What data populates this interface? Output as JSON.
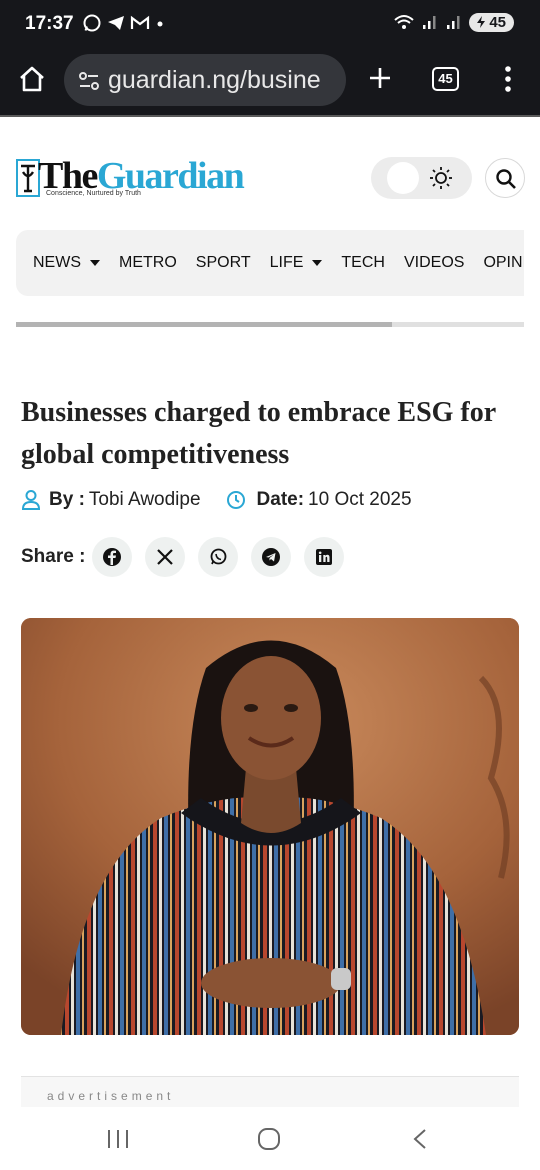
{
  "status_bar": {
    "time": "17:37",
    "battery": "45",
    "icons": [
      "whatsapp-icon",
      "telegram-icon",
      "gmail-icon",
      "dot-icon",
      "wifi-icon",
      "signal-icon",
      "signal-icon",
      "battery-icon"
    ]
  },
  "browser": {
    "url": "guardian.ng/busine",
    "tab_count": "45"
  },
  "site": {
    "logo_the": "The",
    "logo_guardian": "Guardian",
    "tagline": "Conscience, Nurtured by Truth"
  },
  "nav": {
    "items": [
      {
        "label": "NEWS",
        "dropdown": true
      },
      {
        "label": "METRO",
        "dropdown": false
      },
      {
        "label": "SPORT",
        "dropdown": false
      },
      {
        "label": "LIFE",
        "dropdown": true
      },
      {
        "label": "TECH",
        "dropdown": false
      },
      {
        "label": "VIDEOS",
        "dropdown": false
      },
      {
        "label": "OPINION",
        "dropdown": false
      }
    ],
    "progress_fraction": 0.74
  },
  "article": {
    "headline": "Businesses charged to embrace ESG for global competitiveness",
    "by_label": "By :",
    "author": "Tobi Awodipe",
    "date_label": "Date:",
    "date": "10 Oct 2025",
    "share_label": "Share :",
    "share_buttons": [
      "facebook-icon",
      "x-icon",
      "whatsapp-icon",
      "telegram-icon",
      "linkedin-icon"
    ]
  },
  "ad": {
    "label": "advertisement"
  },
  "colors": {
    "brand_blue": "#2aa7d4",
    "status_bar_bg": "#16171b",
    "icon_accent": "#2aa7d4"
  }
}
